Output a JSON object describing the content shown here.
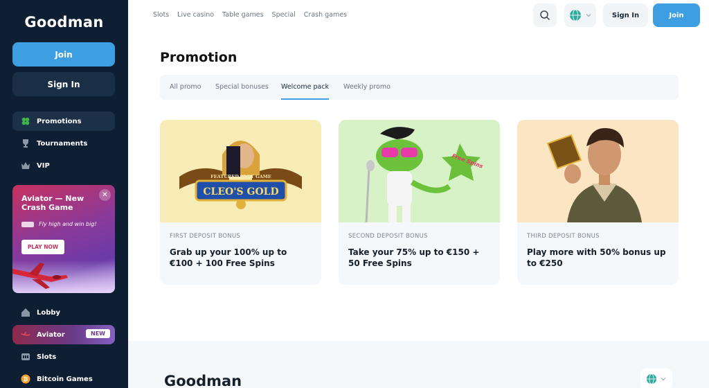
{
  "brand": "Goodman",
  "sidebar": {
    "join_label": "Join",
    "signin_label": "Sign In",
    "menu": [
      {
        "label": "Promotions",
        "icon": "clover-icon"
      },
      {
        "label": "Tournaments",
        "icon": "trophy-icon"
      },
      {
        "label": "VIP",
        "icon": "crown-icon"
      }
    ],
    "promo_card": {
      "title": "Aviator — New Crash Game",
      "tagline": "Fly high and win big!",
      "cta": "PLAY NOW"
    },
    "games": [
      {
        "label": "Lobby",
        "icon": "house-icon"
      },
      {
        "label": "Aviator",
        "icon": "plane-icon",
        "badge": "NEW"
      },
      {
        "label": "Slots",
        "icon": "slot-icon"
      },
      {
        "label": "Bitcoin Games",
        "icon": "bitcoin-icon"
      }
    ]
  },
  "topbar": {
    "nav": [
      "Slots",
      "Live casino",
      "Table games",
      "Special",
      "Crash games"
    ],
    "signin_label": "Sign In",
    "join_label": "Join"
  },
  "main": {
    "title": "Promotion",
    "tabs": [
      "All promo",
      "Special bonuses",
      "Welcome pack",
      "Weekly promo"
    ],
    "active_tab": "Welcome pack",
    "cards": [
      {
        "kicker": "FIRST DEPOSIT BONUS",
        "title": "Grab up your 100% up to €100 + 100 Free Spins",
        "image_text": "CLEO'S GOLD",
        "image_subtext": "FEATURED SLOT GAME"
      },
      {
        "kicker": "SECOND DEPOSIT BONUS",
        "title": "Take your 75% up to €150 + 50 Free Spins",
        "image_text": "Free Spins"
      },
      {
        "kicker": "THIRD DEPOSIT BONUS",
        "title": "Play more with 50% bonus up to €250"
      }
    ]
  },
  "footer": {
    "brand": "Goodman"
  },
  "colors": {
    "sidebar_bg": "#0f1f33",
    "accent": "#3d9fe2",
    "card_bg": "#f5f8fa"
  }
}
